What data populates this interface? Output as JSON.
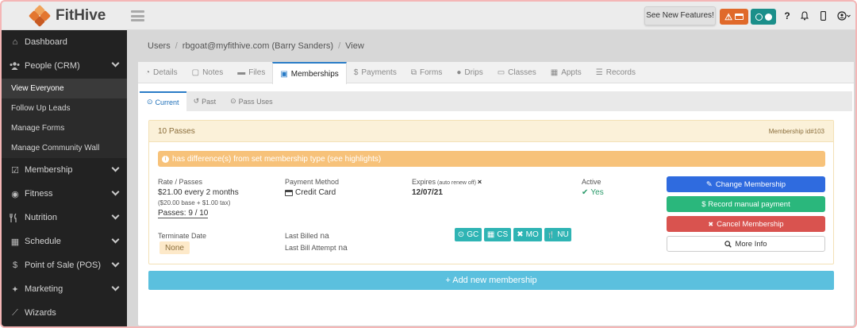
{
  "brand": {
    "name": "FitHive"
  },
  "topbar": {
    "features_label": "See New Features!",
    "warn_symbol": "⚠",
    "help_symbol": "?"
  },
  "sidebar": {
    "items": [
      {
        "label": "Dashboard",
        "icon": "home-icon",
        "glyph": "⌂"
      },
      {
        "label": "People (CRM)",
        "icon": "people-icon",
        "glyph": "👥"
      },
      {
        "label": "Membership",
        "icon": "checkbox-icon",
        "glyph": "☑"
      },
      {
        "label": "Fitness",
        "icon": "fitness-icon",
        "glyph": "◉"
      },
      {
        "label": "Nutrition",
        "icon": "utensils-icon",
        "glyph": "🍴"
      },
      {
        "label": "Schedule",
        "icon": "calendar-icon",
        "glyph": "▦"
      },
      {
        "label": "Point of Sale (POS)",
        "icon": "dollar-icon",
        "glyph": "$"
      },
      {
        "label": "Marketing",
        "icon": "compass-icon",
        "glyph": "✦"
      },
      {
        "label": "Wizards",
        "icon": "magic-wand-icon",
        "glyph": "⟋"
      }
    ],
    "sub_items": [
      {
        "label": "View Everyone"
      },
      {
        "label": "Follow Up Leads"
      },
      {
        "label": "Manage Forms"
      },
      {
        "label": "Manage Community Wall"
      }
    ]
  },
  "breadcrumb": [
    "Users",
    "rbgoat@myfithive.com (Barry Sanders)",
    "View"
  ],
  "breadcrumb_sep": "/",
  "tabs": [
    {
      "label": "Details",
      "glyph": "◔"
    },
    {
      "label": "Notes",
      "glyph": "▢"
    },
    {
      "label": "Files",
      "glyph": "▬"
    },
    {
      "label": "Memberships",
      "glyph": "▣"
    },
    {
      "label": "Payments",
      "glyph": "$"
    },
    {
      "label": "Forms",
      "glyph": "⧉"
    },
    {
      "label": "Drips",
      "glyph": "●"
    },
    {
      "label": "Classes",
      "glyph": "▭"
    },
    {
      "label": "Appts",
      "glyph": "▦"
    },
    {
      "label": "Records",
      "glyph": "☰"
    }
  ],
  "subtabs": [
    {
      "label": "Current",
      "glyph": "⊙"
    },
    {
      "label": "Past",
      "glyph": "↺"
    },
    {
      "label": "Pass Uses",
      "glyph": "⊙"
    }
  ],
  "membership": {
    "title": "10 Passes",
    "id_text": "Membership id#103",
    "alert": "has difference(s) from set membership type (see highlights)",
    "rate_label": "Rate / Passes",
    "rate_value": "$21.00 every 2 months",
    "rate_detail": "($20.00 base + $1.00 tax)",
    "passes": "Passes: 9 / 10",
    "payment_label": "Payment Method",
    "payment_value": "Credit Card",
    "expires_label": "Expires",
    "expires_note": "(auto renew off)",
    "expires_x": "×",
    "expires_value": "12/07/21",
    "active_label": "Active",
    "active_value": "Yes",
    "terminate_label": "Terminate Date",
    "terminate_value": "None",
    "last_billed_label": "Last Billed",
    "last_billed_value": "na",
    "last_attempt_label": "Last Bill Attempt",
    "last_attempt_value": "na",
    "mini_buttons": [
      {
        "label": "GC",
        "glyph": "⊙"
      },
      {
        "label": "CS",
        "glyph": "▦"
      },
      {
        "label": "MO",
        "glyph": "✖"
      },
      {
        "label": "NU",
        "glyph": "🍴"
      }
    ]
  },
  "actions": {
    "change": "Change Membership",
    "record": "$ Record manual payment",
    "cancel": "Cancel Membership",
    "more": "More Info"
  },
  "add_membership": "+ Add new membership",
  "colors": {
    "primary": "#2f6bdf",
    "success": "#2ab77c",
    "danger": "#d9534f",
    "info": "#5bc0de",
    "warning": "#f7c27a",
    "teal": "#2fb4b4"
  }
}
